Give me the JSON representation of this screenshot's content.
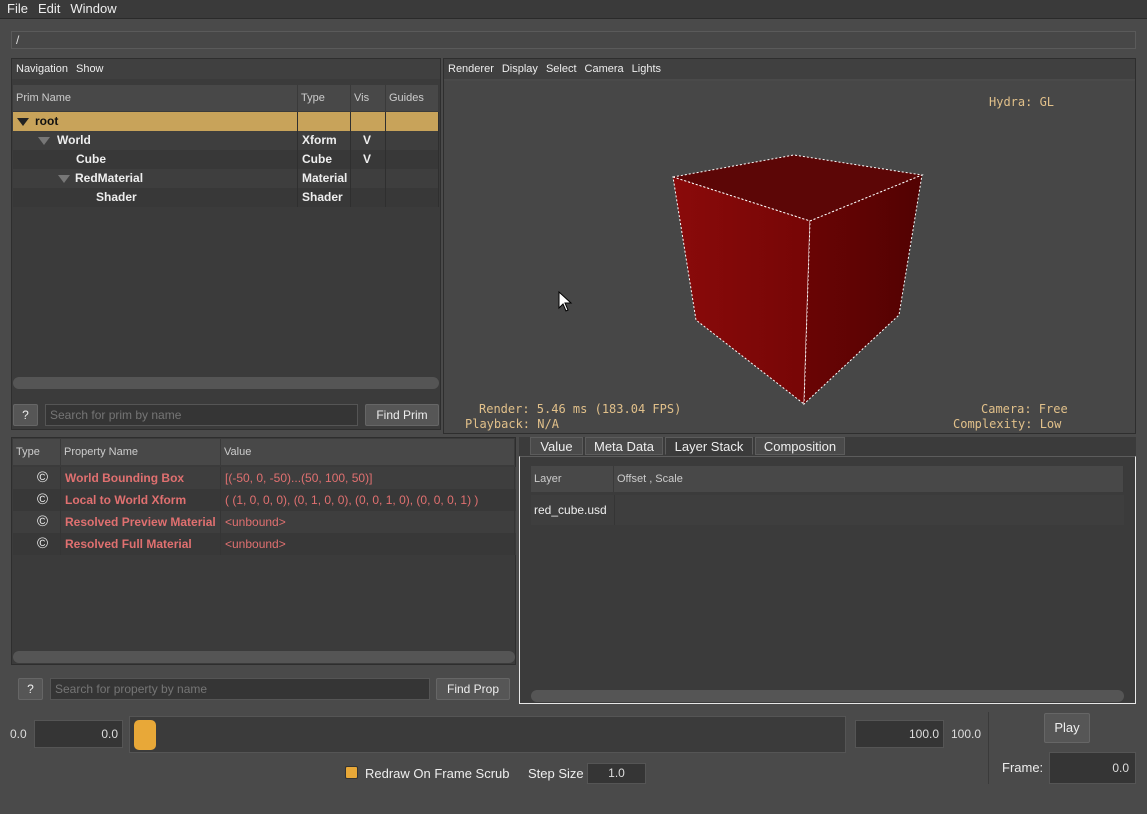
{
  "menubar": {
    "items": [
      "File",
      "Edit",
      "Window"
    ]
  },
  "path": "/",
  "browser": {
    "menus": [
      "Navigation",
      "Show"
    ],
    "headers": [
      "Prim Name",
      "Type",
      "Vis",
      "Guides"
    ],
    "rows": [
      {
        "name": "root",
        "type": "",
        "vis": "",
        "expanded": true,
        "selected": true
      },
      {
        "name": "World",
        "type": "Xform",
        "vis": "V",
        "expanded": true,
        "selected": false
      },
      {
        "name": "Cube",
        "type": "Cube",
        "vis": "V",
        "expanded": false,
        "selected": false
      },
      {
        "name": "RedMaterial",
        "type": "Material",
        "vis": "",
        "expanded": true,
        "selected": false
      },
      {
        "name": "Shader",
        "type": "Shader",
        "vis": "",
        "expanded": false,
        "selected": false
      }
    ],
    "help_label": "?",
    "search_placeholder": "Search for prim by name",
    "find_label": "Find Prim"
  },
  "viewport": {
    "menus": [
      "Renderer",
      "Display",
      "Select",
      "Camera",
      "Lights"
    ],
    "renderer_hud": "Hydra: GL",
    "render_stats": "Render: 5.46 ms (183.04 FPS)",
    "playback": "Playback: N/A",
    "camera": "Camera: Free",
    "complexity": "Complexity: Low",
    "cube_color": "#8b0a0a"
  },
  "properties": {
    "headers": [
      "Type",
      "Property Name",
      "Value"
    ],
    "rows": [
      {
        "icon": "©",
        "name": "World Bounding Box",
        "value": "[(-50, 0, -50)...(50, 100, 50)]"
      },
      {
        "icon": "©",
        "name": "Local to World Xform",
        "value": "( (1, 0, 0, 0), (0, 1, 0, 0), (0, 0, 1, 0), (0, 0, 0, 1) )"
      },
      {
        "icon": "©",
        "name": "Resolved Preview Material",
        "value": "<unbound>"
      },
      {
        "icon": "©",
        "name": "Resolved Full Material",
        "value": "<unbound>"
      }
    ],
    "help_label": "?",
    "search_placeholder": "Search for property by name",
    "find_label": "Find Prop",
    "name_color": "#e07070"
  },
  "inspector": {
    "tabs": [
      "Value",
      "Meta Data",
      "Layer Stack",
      "Composition"
    ],
    "active_tab": "Layer Stack",
    "headers": [
      "Layer",
      "Offset , Scale"
    ],
    "rows": [
      {
        "layer": "red_cube.usd",
        "offset": ""
      }
    ]
  },
  "timeline": {
    "start_label": "0.0",
    "start_value": "0.0",
    "end_value": "100.0",
    "end_label": "100.0",
    "play_label": "Play",
    "frame_label": "Frame:",
    "frame_value": "0.0",
    "redraw_label": "Redraw On Frame Scrub",
    "redraw_checked": true,
    "step_label": "Step Size",
    "step_value": "1.0",
    "accent": "#e8a838"
  }
}
